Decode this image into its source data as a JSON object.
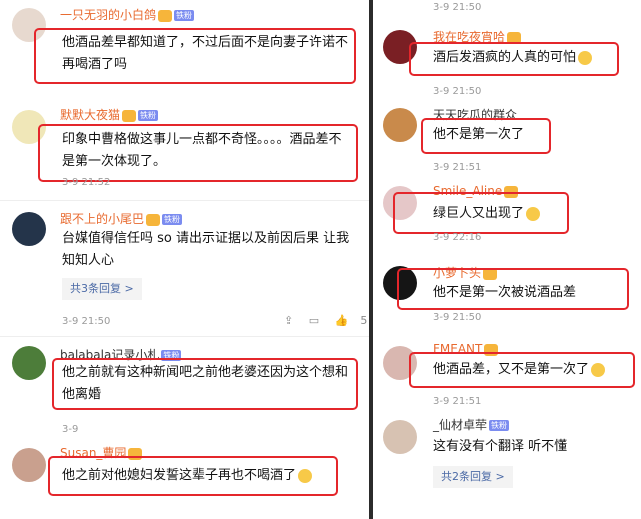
{
  "left": {
    "comments": [
      {
        "user": "一只无羽的小白鸽",
        "text": "他酒品差早都知道了，不过后面不是向妻子许诺不再喝酒了吗",
        "time": "",
        "name_color": "#e86a2f"
      },
      {
        "user": "默默大夜猫",
        "text": "印象中曹格做这事儿一点都不奇怪。。。。酒品差不是第一次体现了。",
        "time": "3-9 21:52",
        "name_color": "#e86a2f"
      },
      {
        "user": "跟不上的小尾巴",
        "text": "台媒值得信任吗 so 请出示证据以及前因后果 让我知知人心",
        "time": "3-9 21:50",
        "name_color": "#e86a2f",
        "replies": "共3条回复 >",
        "likes": "5"
      },
      {
        "user": "balabala记录小札",
        "text": "他之前就有这种新闻吧之前他老婆还因为这个想和他离婚",
        "time": "3-9",
        "name_color": "#333"
      },
      {
        "user": "Susan_曹园",
        "text": "他之前对他媳妇发誓这辈子再也不喝酒了",
        "time": "",
        "name_color": "#e86a2f"
      }
    ]
  },
  "right": {
    "comments": [
      {
        "user": "我在吃夜宵哈",
        "text": "酒后发酒疯的人真的可怕",
        "time": "3-9 21:50",
        "name_color": "#e86a2f"
      },
      {
        "user": "天天吃瓜的群众",
        "text": "他不是第一次了",
        "time": "3-9 21:51",
        "name_color": "#333"
      },
      {
        "user": "Smile_Aline",
        "text": "绿巨人又出现了",
        "time": "3-9 22:16",
        "name_color": "#e86a2f"
      },
      {
        "user": "小萝卜头",
        "text": "他不是第一次被说酒品差",
        "time": "3-9 21:50",
        "name_color": "#e86a2f"
      },
      {
        "user": "FMEANT",
        "text": "他酒品差，又不是第一次了",
        "time": "3-9 21:51",
        "name_color": "#e86a2f"
      },
      {
        "user": "_仙材卓荦",
        "text": "这有没有个翻译 听不懂",
        "time": "",
        "name_color": "#333",
        "replies": "共2条回复 >"
      }
    ],
    "top_time": "3-9 21:50"
  },
  "colors": {
    "highlight_box": "#e4262b",
    "reply_link": "#4b6aa6"
  }
}
